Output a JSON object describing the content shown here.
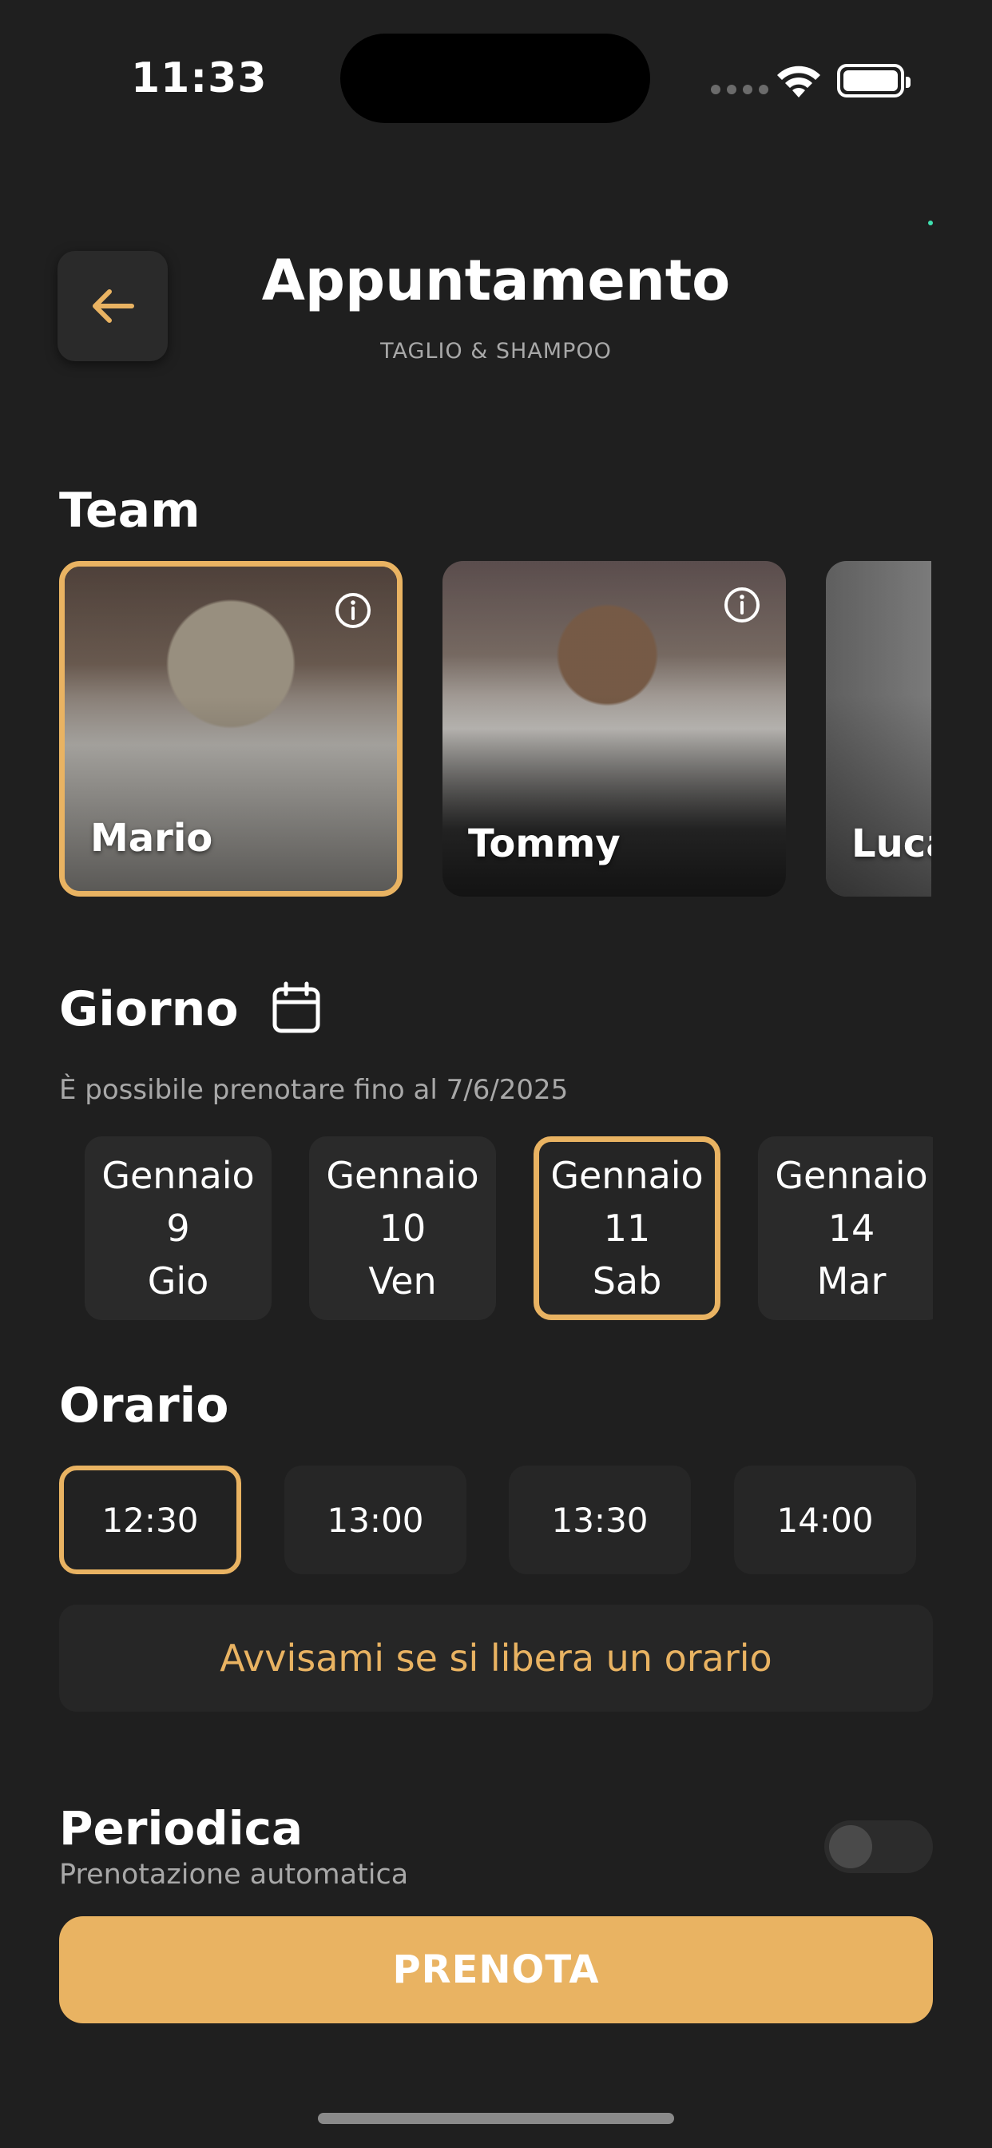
{
  "status_bar": {
    "time": "11:33"
  },
  "header": {
    "title": "Appuntamento",
    "subtitle": "TAGLIO & SHAMPOO"
  },
  "team": {
    "title": "Team",
    "members": [
      {
        "name": "Mario",
        "selected": true
      },
      {
        "name": "Tommy",
        "selected": false
      },
      {
        "name": "Luca",
        "selected": false
      }
    ]
  },
  "day": {
    "title": "Giorno",
    "note": "È possibile prenotare fino al 7/6/2025",
    "days": [
      {
        "month": "Gennaio",
        "date": "9",
        "weekday": "Gio",
        "selected": false
      },
      {
        "month": "Gennaio",
        "date": "10",
        "weekday": "Ven",
        "selected": false
      },
      {
        "month": "Gennaio",
        "date": "11",
        "weekday": "Sab",
        "selected": true
      },
      {
        "month": "Gennaio",
        "date": "14",
        "weekday": "Mar",
        "selected": false
      }
    ]
  },
  "time": {
    "title": "Orario",
    "slots": [
      {
        "label": "12:30",
        "selected": true
      },
      {
        "label": "13:00",
        "selected": false
      },
      {
        "label": "13:30",
        "selected": false
      },
      {
        "label": "14:00",
        "selected": false
      }
    ],
    "notify_label": "Avvisami se si libera un orario"
  },
  "periodic": {
    "title": "Periodica",
    "subtitle": "Prenotazione automatica",
    "enabled": false
  },
  "cta": {
    "label": "PRENOTA"
  },
  "colors": {
    "accent": "#e9b362",
    "background": "#1f1f1f",
    "card": "#2a2a2a"
  }
}
